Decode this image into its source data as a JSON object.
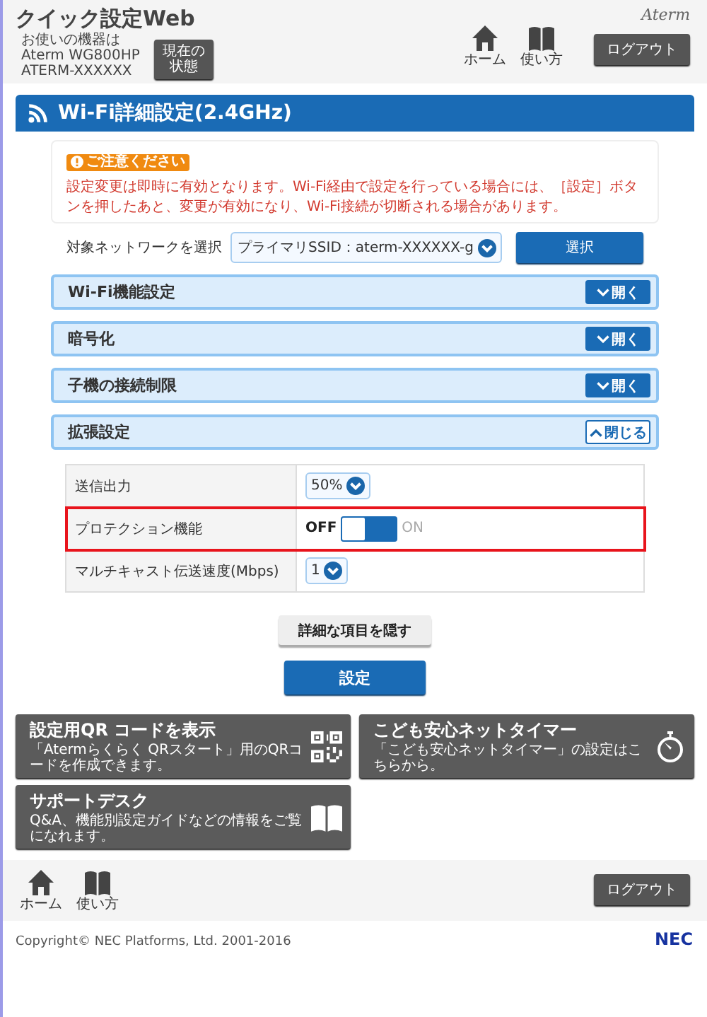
{
  "header": {
    "title": "クイック設定Web",
    "device_label": "お使いの機器は",
    "device_model": "Aterm WG800HP",
    "device_name": "ATERM-XXXXXX",
    "status_button": [
      "現在の",
      "状態"
    ],
    "brand": "Aterm",
    "nav": [
      {
        "label": "ホーム",
        "kind": "home"
      },
      {
        "label": "使い方",
        "kind": "book"
      }
    ],
    "logout": "ログアウト"
  },
  "page_title": "Wi-Fi詳細設定(2.4GHz)",
  "notice": {
    "badge": "ご注意ください",
    "text": "設定変更は即時に有効となります。Wi-Fi経由で設定を行っている場合には、［設定］ボタンを押したあと、変更が有効になり、Wi-Fi接続が切断される場合があります。"
  },
  "network_select": {
    "label": "対象ネットワークを選択",
    "value": "プライマリSSID：aterm-XXXXXX-g",
    "button": "選択"
  },
  "sections": [
    {
      "title": "Wi-Fi機能設定",
      "expanded": false,
      "toggle": "開く"
    },
    {
      "title": "暗号化",
      "expanded": false,
      "toggle": "開く"
    },
    {
      "title": "子機の接続制限",
      "expanded": false,
      "toggle": "開く"
    },
    {
      "title": "拡張設定",
      "expanded": true,
      "toggle": "閉じる",
      "rows": [
        {
          "label": "送信出力",
          "kind": "select",
          "value": "50%",
          "highlighted": false
        },
        {
          "label": "プロテクション機能",
          "kind": "switch",
          "on": false,
          "off_label": "OFF",
          "on_label": "ON",
          "highlighted": true
        },
        {
          "label": "マルチキャスト伝送速度(Mbps)",
          "kind": "select",
          "value": "1",
          "highlighted": false
        }
      ]
    }
  ],
  "hide_button": "詳細な項目を隠す",
  "apply_button": "設定",
  "links": [
    {
      "title": "設定用QR コードを表示",
      "desc": "「Atermらくらく QRスタート」用のQRコードを作成できます。",
      "kind": "qr"
    },
    {
      "title": "こども安心ネットタイマー",
      "desc": "「こども安心ネットタイマー」の設定はこちらから。",
      "kind": "timer"
    },
    {
      "title": "サポートデスク",
      "desc": "Q&A、機能別設定ガイドなどの情報をご覧になれます。",
      "kind": "book"
    }
  ],
  "footer": {
    "nav": [
      {
        "label": "ホーム",
        "kind": "home"
      },
      {
        "label": "使い方",
        "kind": "book"
      }
    ],
    "logout": "ログアウト",
    "copyright": "Copyright© NEC Platforms, Ltd. 2001-2016",
    "logo": "NEC"
  }
}
